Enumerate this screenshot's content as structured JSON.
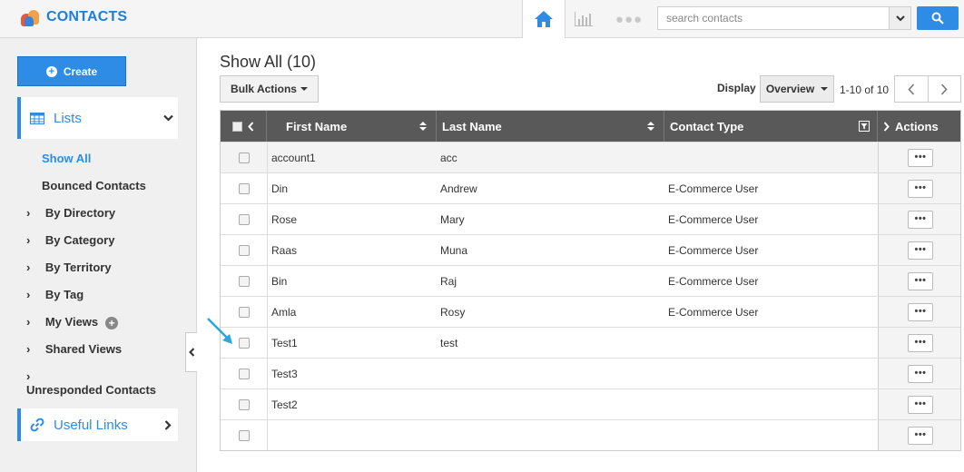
{
  "app": {
    "title": "CONTACTS"
  },
  "search": {
    "placeholder": "search contacts"
  },
  "sidebar": {
    "create_label": "Create",
    "lists_label": "Lists",
    "items": [
      {
        "label": "Show All",
        "active": true
      },
      {
        "label": "Bounced Contacts"
      },
      {
        "label": "By Directory"
      },
      {
        "label": "By Category"
      },
      {
        "label": "By Territory"
      },
      {
        "label": "By Tag"
      },
      {
        "label": "My Views"
      },
      {
        "label": "Shared Views"
      },
      {
        "label": "Unresponded Contacts"
      }
    ],
    "useful_links_label": "Useful Links"
  },
  "main": {
    "title": "Show All (10)",
    "bulk_actions_label": "Bulk Actions",
    "display_label": "Display",
    "display_value": "Overview",
    "range": "1-10 of 10",
    "columns": [
      "First Name",
      "Last Name",
      "Contact Type",
      "Actions"
    ],
    "rows": [
      {
        "first": "account1",
        "last": "acc",
        "type": ""
      },
      {
        "first": "Din",
        "last": "Andrew",
        "type": "E-Commerce User"
      },
      {
        "first": "Rose",
        "last": "Mary",
        "type": "E-Commerce User"
      },
      {
        "first": "Raas",
        "last": "Muna",
        "type": "E-Commerce User"
      },
      {
        "first": "Bin",
        "last": "Raj",
        "type": "E-Commerce User"
      },
      {
        "first": "Amla",
        "last": "Rosy",
        "type": "E-Commerce User"
      },
      {
        "first": "Test1",
        "last": "test",
        "type": ""
      },
      {
        "first": "Test3",
        "last": "",
        "type": ""
      },
      {
        "first": "Test2",
        "last": "",
        "type": ""
      },
      {
        "first": "",
        "last": "",
        "type": ""
      }
    ],
    "row_action_label": "•••"
  },
  "colors": {
    "accent": "#2e8ce6",
    "header_bg": "#595959"
  }
}
